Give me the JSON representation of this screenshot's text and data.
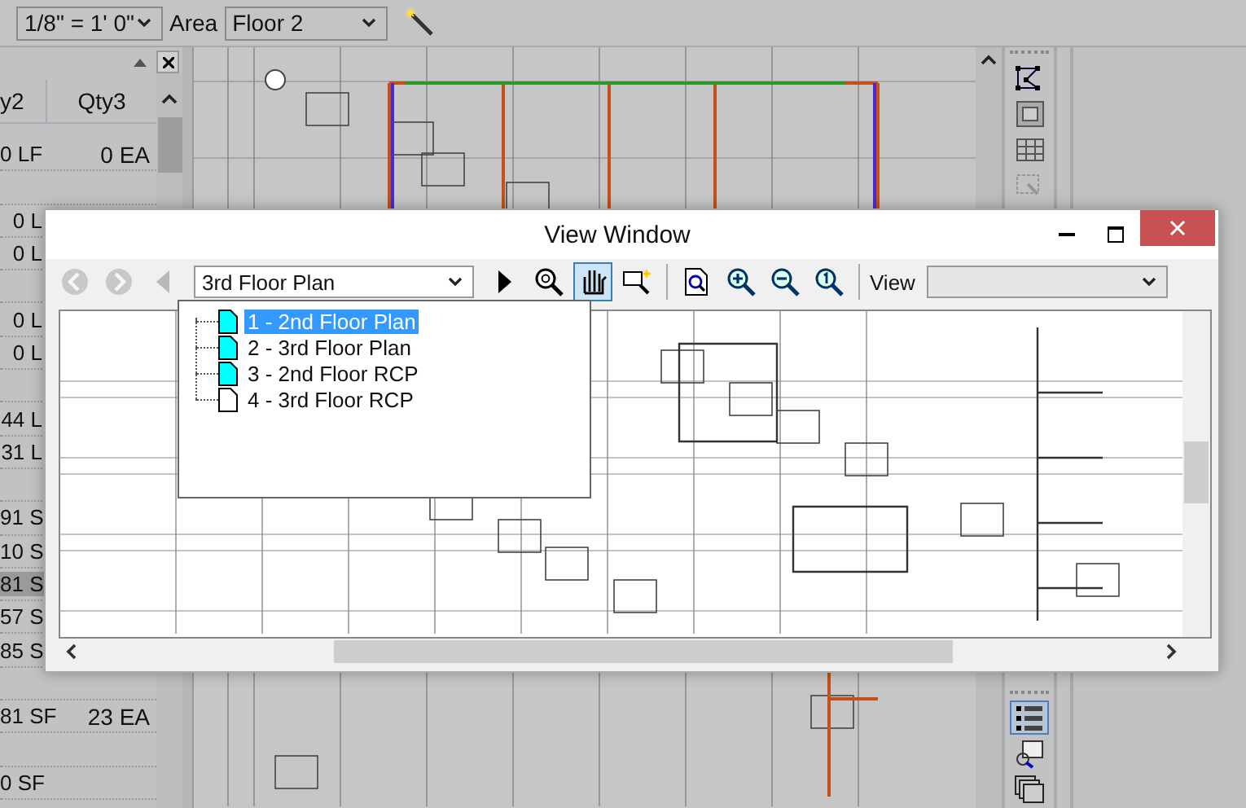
{
  "toolbar": {
    "scale": "1/8\" = 1' 0\"",
    "area_label": "Area",
    "area": "Floor 2"
  },
  "takeoff_panel": {
    "columns": [
      "y2",
      "Qty3"
    ],
    "rows": [
      {
        "kind": "item",
        "qty2": "0 LF",
        "qty3": "0 EA",
        "selected": false
      },
      {
        "kind": "group"
      },
      {
        "kind": "item",
        "qty2": "0 L",
        "selected": false
      },
      {
        "kind": "item",
        "qty2": "0 L",
        "selected": false
      },
      {
        "kind": "group"
      },
      {
        "kind": "item",
        "qty2": "0 L",
        "selected": false
      },
      {
        "kind": "item",
        "qty2": "0 L",
        "selected": false
      },
      {
        "kind": "group"
      },
      {
        "kind": "item",
        "qty2": "44 L",
        "selected": false
      },
      {
        "kind": "item",
        "qty2": "31 L",
        "selected": false
      },
      {
        "kind": "group"
      },
      {
        "kind": "item",
        "qty2": "91 S",
        "selected": false
      },
      {
        "kind": "item",
        "qty2": "10 S",
        "selected": false
      },
      {
        "kind": "item",
        "qty2": "81 S",
        "selected": true
      },
      {
        "kind": "item",
        "qty2": "57 S",
        "selected": false
      },
      {
        "kind": "item",
        "qty2": "85 S",
        "selected": false
      },
      {
        "kind": "group"
      },
      {
        "kind": "item",
        "qty2": "81 SF",
        "qty3": "23 EA",
        "selected": false
      },
      {
        "kind": "group"
      },
      {
        "kind": "item",
        "qty2": "0 SF",
        "selected": false
      }
    ]
  },
  "side_tools": [
    {
      "kind": "polygon",
      "selected": false,
      "disabled": false
    },
    {
      "kind": "hatch",
      "selected": false,
      "disabled": false
    },
    {
      "kind": "grid",
      "selected": false,
      "disabled": false
    },
    {
      "kind": "select",
      "selected": false,
      "disabled": true
    },
    {
      "kind": "list",
      "selected": true,
      "disabled": false
    },
    {
      "kind": "inspect",
      "selected": false,
      "disabled": false
    },
    {
      "kind": "windows",
      "selected": false,
      "disabled": false
    }
  ],
  "view_window": {
    "title": "View Window",
    "page": "3rd Floor Plan",
    "view_label": "View",
    "tools": [
      {
        "kind": "back",
        "selected": false,
        "disabled": true
      },
      {
        "kind": "forward",
        "selected": false,
        "disabled": true
      },
      {
        "kind": "prev",
        "selected": false,
        "disabled": true
      },
      {
        "kind": "page"
      },
      {
        "kind": "next",
        "selected": false,
        "disabled": false
      },
      {
        "kind": "zoom-window",
        "selected": false,
        "disabled": false
      },
      {
        "kind": "pan",
        "selected": true,
        "disabled": false
      },
      {
        "kind": "zoom-select",
        "selected": false,
        "disabled": false
      },
      {
        "kind": "sep"
      },
      {
        "kind": "zoom-page",
        "selected": false,
        "disabled": false
      },
      {
        "kind": "zoom-in",
        "selected": false,
        "disabled": false
      },
      {
        "kind": "zoom-out",
        "selected": false,
        "disabled": false
      },
      {
        "kind": "zoom-actual",
        "selected": false,
        "disabled": false
      },
      {
        "kind": "sep"
      },
      {
        "kind": "view"
      }
    ],
    "pages": [
      {
        "label": "1 - 2nd Floor Plan",
        "selected": true,
        "color": "#00ffff"
      },
      {
        "label": "2 - 3rd Floor Plan",
        "selected": false,
        "color": "#00ffff"
      },
      {
        "label": "3 - 2nd Floor RCP",
        "selected": false,
        "color": "#00ffff"
      },
      {
        "label": "4 - 3rd Floor RCP",
        "selected": false,
        "color": "#ffffff"
      }
    ]
  }
}
